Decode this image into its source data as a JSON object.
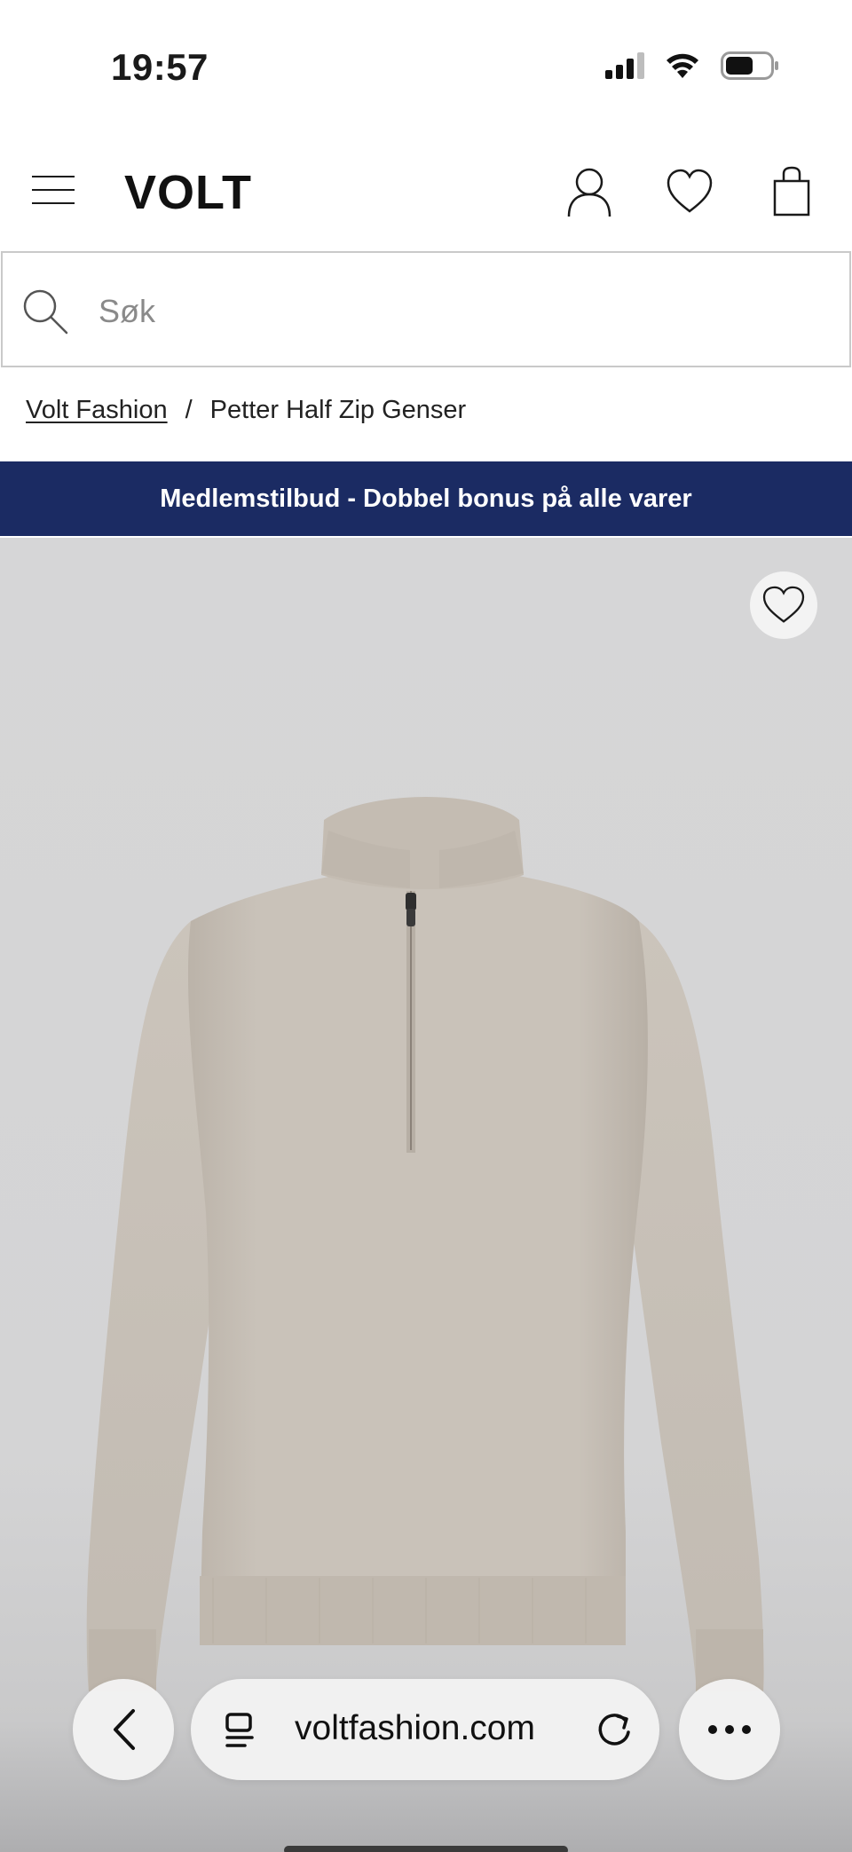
{
  "status_bar": {
    "time": "19:57",
    "icons": [
      "cellular-signal-icon",
      "wifi-icon",
      "battery-icon"
    ]
  },
  "header": {
    "logo": "VOLT",
    "icons": [
      "menu-icon",
      "account-icon",
      "heart-icon",
      "shopping-bag-icon"
    ]
  },
  "search": {
    "placeholder": "Søk",
    "value": ""
  },
  "breadcrumb": {
    "home": "Volt Fashion",
    "separator": "/",
    "current": "Petter Half Zip Genser"
  },
  "promo": {
    "text": "Medlemstilbud - Dobbel bonus på alle varer",
    "background": "#1b2b63"
  },
  "product": {
    "image": "beige half-zip knit sweater",
    "favorite_icon": "heart-icon"
  },
  "browser": {
    "url": "voltfashion.com",
    "icons": [
      "back-chevron-icon",
      "page-menu-icon",
      "reload-icon",
      "more-icon"
    ]
  }
}
